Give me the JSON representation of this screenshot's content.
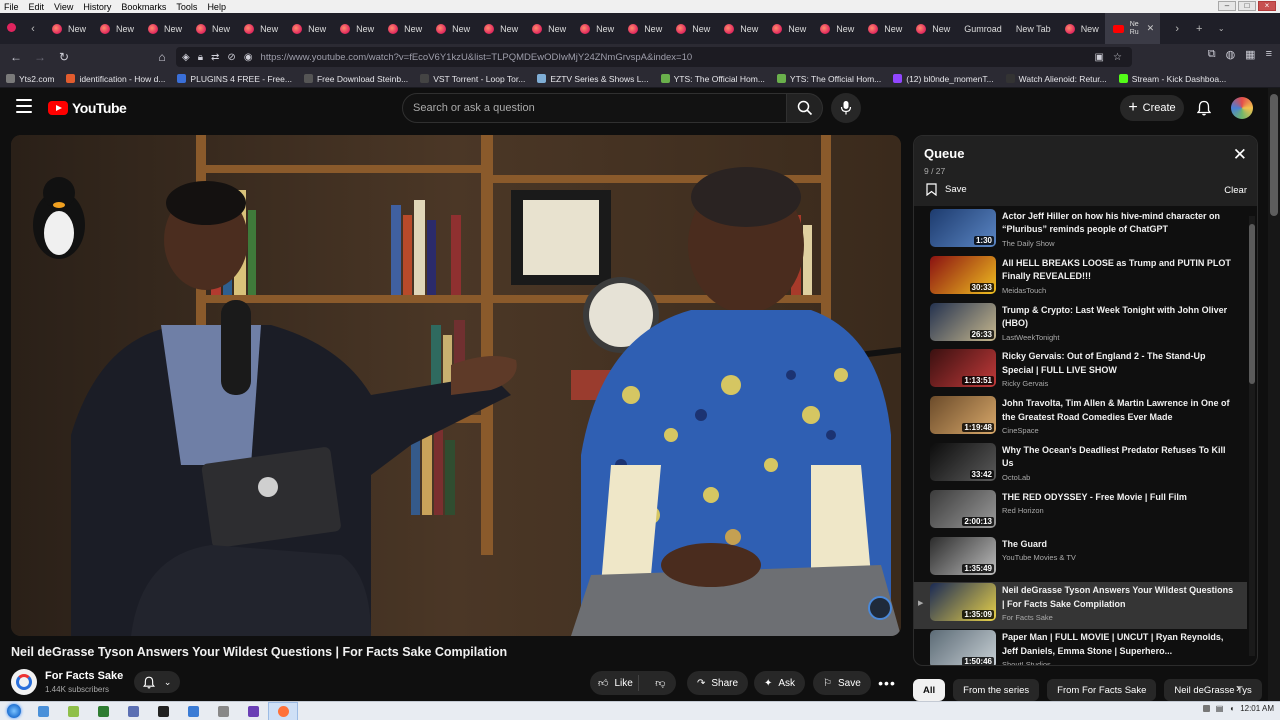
{
  "menubar": {
    "items": [
      "File",
      "Edit",
      "View",
      "History",
      "Bookmarks",
      "Tools",
      "Help"
    ]
  },
  "tabs": [
    {
      "label": "New"
    },
    {
      "label": "New"
    },
    {
      "label": "New"
    },
    {
      "label": "New"
    },
    {
      "label": "New"
    },
    {
      "label": "New"
    },
    {
      "label": "New"
    },
    {
      "label": "New"
    },
    {
      "label": "New"
    },
    {
      "label": "New"
    },
    {
      "label": "New"
    },
    {
      "label": "New"
    },
    {
      "label": "New"
    },
    {
      "label": "New"
    },
    {
      "label": "New"
    },
    {
      "label": "New"
    },
    {
      "label": "New"
    },
    {
      "label": "New"
    },
    {
      "label": "New"
    },
    {
      "label": "Gumroad",
      "plain": true
    },
    {
      "label": "New Tab",
      "plain": true
    },
    {
      "label": "New"
    },
    {
      "label": "Ne\nRu",
      "active": true
    }
  ],
  "address_bar": {
    "url": "https://www.youtube.com/watch?v=fEcoV6Y1kzU&list=TLPQMDEwODIwMjY24ZNmGrvspA&index=10"
  },
  "bookmarks": [
    {
      "label": "Yts2.com",
      "color": "#7a7a7a"
    },
    {
      "label": "identification - How d...",
      "color": "#e25c2e"
    },
    {
      "label": "PLUGINS 4 FREE - Free...",
      "color": "#3a6fd8"
    },
    {
      "label": "Free Download Steinb...",
      "color": "#555555"
    },
    {
      "label": "VST Torrent - Loop Tor...",
      "color": "#444444"
    },
    {
      "label": "EZTV Series & Shows L...",
      "color": "#7faed6"
    },
    {
      "label": "YTS: The Official Hom...",
      "color": "#6ab04c"
    },
    {
      "label": "YTS: The Official Hom...",
      "color": "#6ab04c"
    },
    {
      "label": "(12) bl0nde_momenT...",
      "color": "#9146ff"
    },
    {
      "label": "Watch Alienoid: Retur...",
      "color": "#333333"
    },
    {
      "label": "Stream - Kick Dashboa...",
      "color": "#53fc18"
    }
  ],
  "youtube": {
    "logo_text": "YouTube",
    "search_placeholder": "Search or ask a question",
    "create_label": "Create"
  },
  "video": {
    "title": "Neil deGrasse Tyson Answers Your Wildest Questions | For Facts Sake Compilation",
    "channel": "For Facts Sake",
    "subscribers": "1.44K subscribers",
    "like_label": "Like",
    "share_label": "Share",
    "ask_label": "Ask",
    "save_label": "Save",
    "more_label": "•••"
  },
  "queue": {
    "title": "Queue",
    "position": "9 / 27",
    "save_label": "Save",
    "clear_label": "Clear",
    "items": [
      {
        "title": "Actor Jeff Hiller on how his hive-mind character on “Pluribus” reminds people of ChatGPT",
        "channel": "The Daily Show",
        "duration": "1:30",
        "thumb": [
          "#1d3b6e",
          "#5b86c4"
        ]
      },
      {
        "title": "All HELL BREAKS LOOSE as Trump and PUTIN PLOT Finally REVEALED!!!",
        "channel": "MeidasTouch",
        "duration": "30:33",
        "thumb": [
          "#8a1111",
          "#f0c020"
        ]
      },
      {
        "title": "Trump & Crypto: Last Week Tonight with John Oliver (HBO)",
        "channel": "LastWeekTonight",
        "duration": "26:33",
        "thumb": [
          "#24324f",
          "#c7b88e"
        ]
      },
      {
        "title": "Ricky Gervais: Out of England 2 - The Stand-Up Special | FULL LIVE SHOW",
        "channel": "Ricky Gervais",
        "duration": "1:13:51",
        "thumb": [
          "#3a1010",
          "#c23a3a"
        ]
      },
      {
        "title": "John Travolta, Tim Allen & Martin Lawrence in One of the Greatest Road Comedies Ever Made",
        "channel": "CineSpace",
        "duration": "1:19:48",
        "thumb": [
          "#6b4b2a",
          "#d8a86a"
        ]
      },
      {
        "title": "Why The Ocean's Deadliest Predator Refuses To Kill Us",
        "channel": "OctoLab",
        "duration": "33:42",
        "thumb": [
          "#0c0c0c",
          "#5b5b5b"
        ]
      },
      {
        "title": "THE RED ODYSSEY - Free Movie | Full Film",
        "channel": "Red Horizon",
        "duration": "2:00:13",
        "thumb": [
          "#3b3b3b",
          "#9a9a9a"
        ]
      },
      {
        "title": "The Guard",
        "channel": "YouTube Movies & TV",
        "duration": "1:35:49",
        "thumb": [
          "#2c2c2c",
          "#bdbdbd"
        ]
      },
      {
        "title": "Neil deGrasse Tyson Answers Your Wildest Questions | For Facts Sake Compilation",
        "channel": "For Facts Sake",
        "duration": "1:35:09",
        "thumb": [
          "#1a2a55",
          "#e9d24a"
        ],
        "current": true
      },
      {
        "title": "Paper Man | FULL MOVIE | UNCUT | Ryan Reynolds, Jeff Daniels, Emma Stone | Superhero...",
        "channel": "Shout! Studios",
        "duration": "1:50:46",
        "thumb": [
          "#5c6b76",
          "#c9d1d6"
        ]
      }
    ]
  },
  "chips": [
    "All",
    "From the series",
    "From For Facts Sake",
    "Neil deGrasse Tys"
  ],
  "taskbar": {
    "apps": [
      {
        "color": "#4a90d9"
      },
      {
        "color": "#8fbf4a"
      },
      {
        "color": "#2f7d32"
      },
      {
        "color": "#5b6fb3"
      },
      {
        "color": "#222222"
      },
      {
        "color": "#3a7bd5"
      },
      {
        "color": "#888888"
      },
      {
        "color": "#6a3fb5"
      },
      {
        "color": "#ff7139",
        "active": true
      }
    ],
    "clock": "12:01 AM"
  },
  "colors": {
    "accent_red": "#ff0000",
    "bg": "#0f0f0f"
  }
}
